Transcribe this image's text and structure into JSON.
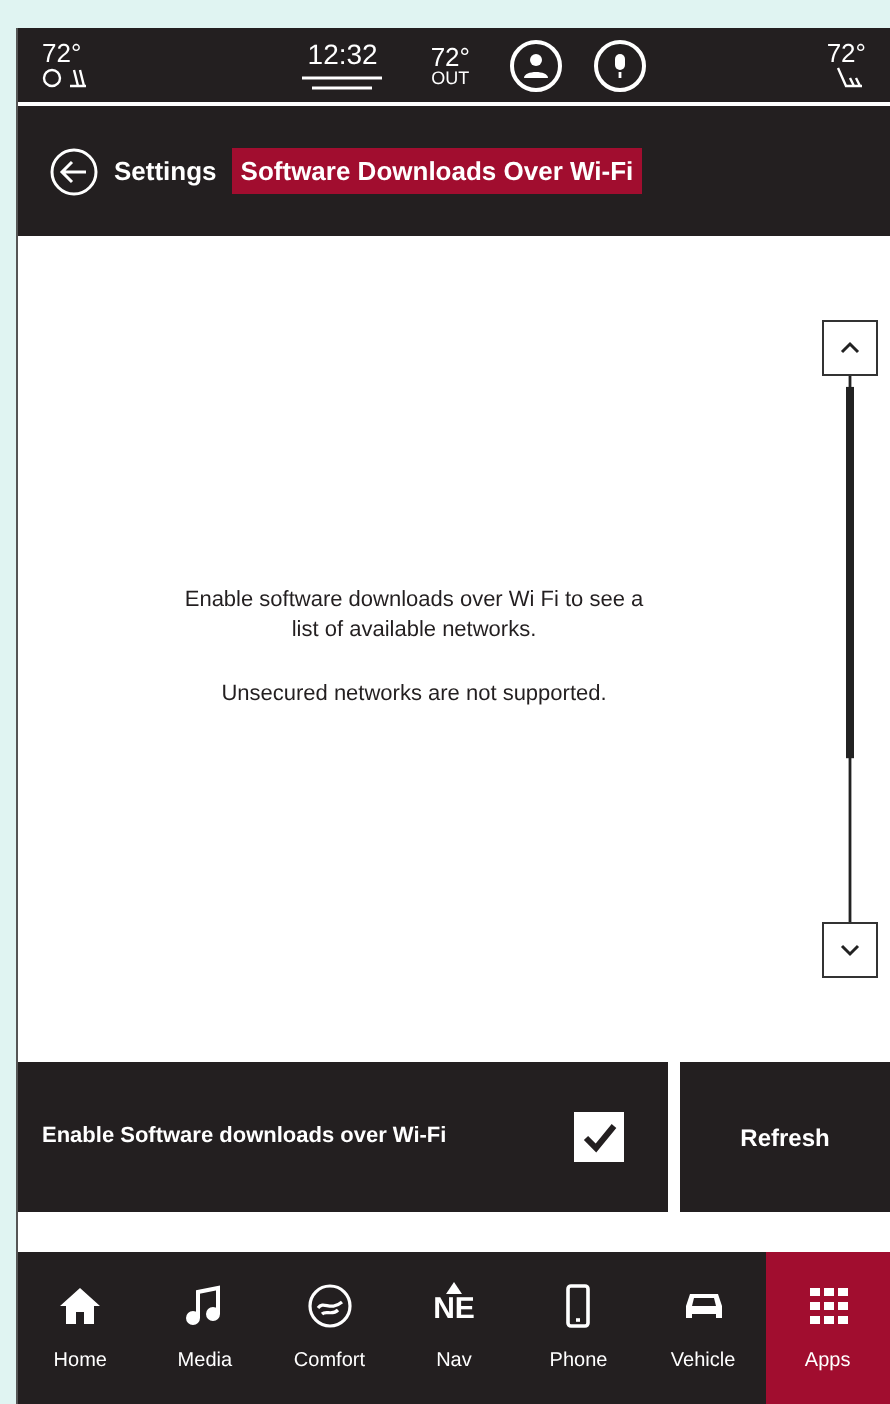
{
  "status_bar": {
    "left_temp": "72°",
    "time": "12:32",
    "outside_temp": "72°",
    "outside_label": "OUT",
    "right_temp": "72°"
  },
  "header": {
    "back": "Settings",
    "title": "Software Downloads Over Wi-Fi"
  },
  "message": {
    "line_1": "Enable software downloads over Wi Fi to see a list of available networks.",
    "line_2": "Unsecured networks are not supported."
  },
  "toggle": {
    "label": "Enable Software downloads over Wi-Fi",
    "checked": true
  },
  "refresh": "Refresh",
  "nav": [
    {
      "kind": "home",
      "label": "Home",
      "selected": false
    },
    {
      "kind": "media",
      "label": "Media",
      "selected": false
    },
    {
      "kind": "comfort",
      "label": "Comfort",
      "selected": false
    },
    {
      "kind": "nav",
      "label": "Nav",
      "heading": "NE",
      "selected": false
    },
    {
      "kind": "phone",
      "label": "Phone",
      "selected": false
    },
    {
      "kind": "vehicle",
      "label": "Vehicle",
      "selected": false
    },
    {
      "kind": "apps",
      "label": "Apps",
      "selected": true
    }
  ]
}
